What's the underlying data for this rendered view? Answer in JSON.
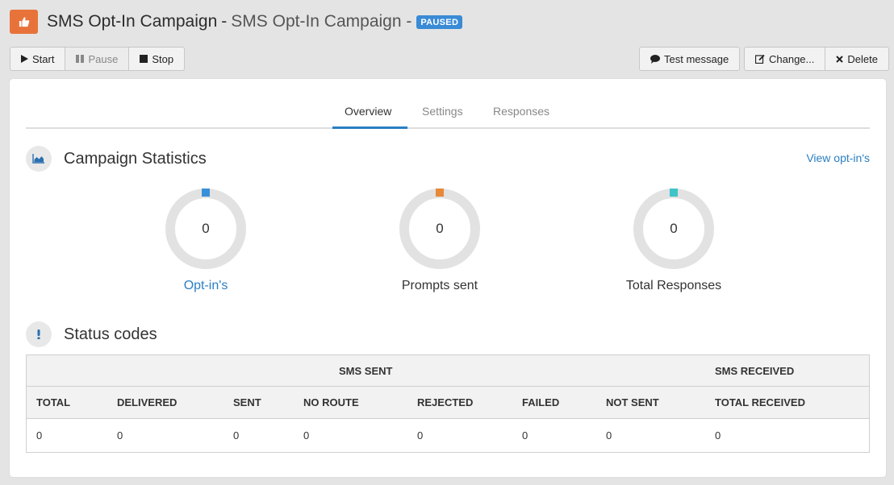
{
  "header": {
    "title_main": "SMS Opt-In Campaign",
    "separator": "-",
    "title_sub": "SMS Opt-In Campaign -",
    "status_badge": "PAUSED",
    "logo_icon": "thumbs-up-icon",
    "brand_color": "#e8733a"
  },
  "toolbar": {
    "start_label": "Start",
    "pause_label": "Pause",
    "stop_label": "Stop",
    "test_message_label": "Test message",
    "change_label": "Change...",
    "delete_label": "Delete"
  },
  "tabs": [
    {
      "label": "Overview",
      "active": true
    },
    {
      "label": "Settings",
      "active": false
    },
    {
      "label": "Responses",
      "active": false
    }
  ],
  "campaign_stats": {
    "title": "Campaign Statistics",
    "view_link": "View opt-in's",
    "stats": [
      {
        "label": "Opt-in's",
        "value": "0",
        "color": "#3a8fd9"
      },
      {
        "label": "Prompts sent",
        "value": "0",
        "color": "#e8883a"
      },
      {
        "label": "Total Responses",
        "value": "0",
        "color": "#3fc4c9"
      }
    ]
  },
  "status_codes": {
    "title": "Status codes",
    "group_sent": "SMS SENT",
    "group_received": "SMS RECEIVED",
    "columns": [
      "TOTAL",
      "DELIVERED",
      "SENT",
      "NO ROUTE",
      "REJECTED",
      "FAILED",
      "NOT SENT",
      "TOTAL RECEIVED"
    ],
    "values": [
      "0",
      "0",
      "0",
      "0",
      "0",
      "0",
      "0",
      "0"
    ]
  }
}
